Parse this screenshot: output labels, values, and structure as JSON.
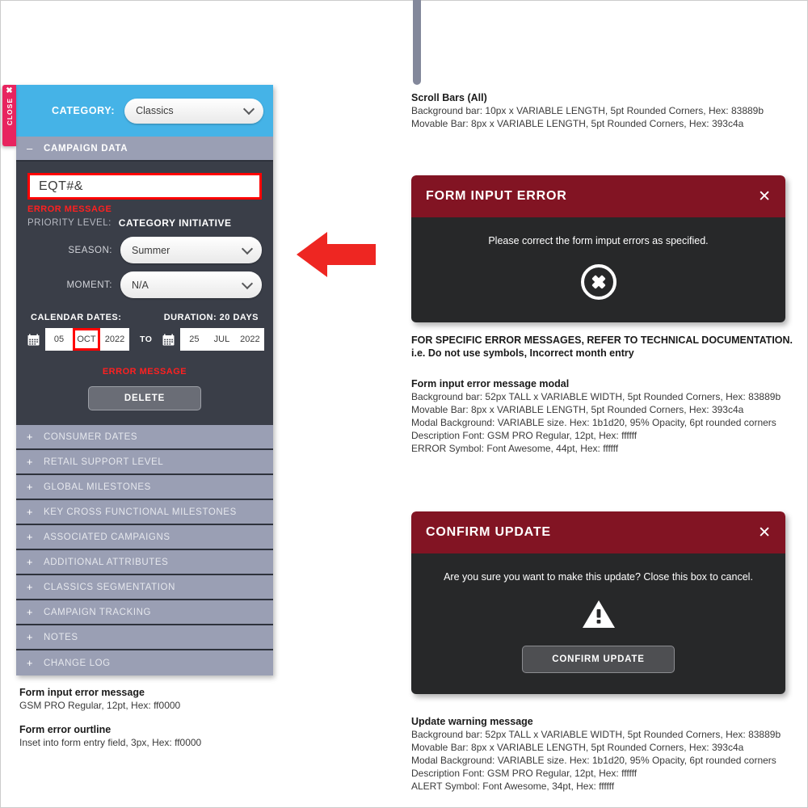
{
  "left_panel": {
    "close_tab": {
      "label": "CLOSE",
      "icon": "close-x-icon"
    },
    "header": {
      "label": "CATEGORY:",
      "category_value": "Classics",
      "bg_hex": "#45b3e7"
    },
    "campaign_section": {
      "sign": "–",
      "title": "CAMPAIGN DATA",
      "name_value": "EQT#&",
      "name_error": "ERROR MESSAGE",
      "priority_label": "PRIORITY LEVEL:",
      "priority_value": "CATEGORY INITIATIVE",
      "season_label": "SEASON:",
      "season_value": "Summer",
      "moment_label": "MOMENT:",
      "moment_value": "N/A",
      "calendar_dates_label": "CALENDAR DATES:",
      "duration_label": "DURATION: 20 DAYS",
      "start_day": "05",
      "start_month": "OCT",
      "start_year": "2022",
      "to_label": "TO",
      "end_day": "25",
      "end_month": "JUL",
      "end_year": "2022",
      "dates_error": "ERROR MESSAGE",
      "delete_label": "DELETE"
    },
    "accordion": [
      {
        "sign": "+",
        "label": "CONSUMER DATES"
      },
      {
        "sign": "+",
        "label": "RETAIL SUPPORT LEVEL"
      },
      {
        "sign": "+",
        "label": "GLOBAL MILESTONES"
      },
      {
        "sign": "+",
        "label": "KEY CROSS FUNCTIONAL MILESTONES"
      },
      {
        "sign": "+",
        "label": "ASSOCIATED CAMPAIGNS"
      },
      {
        "sign": "+",
        "label": "ADDITIONAL ATTRIBUTES"
      },
      {
        "sign": "+",
        "label": "CLASSICS SEGMENTATION"
      },
      {
        "sign": "+",
        "label": "CAMPAIGN TRACKING"
      },
      {
        "sign": "+",
        "label": "NOTES"
      },
      {
        "sign": "+",
        "label": "CHANGE LOG"
      }
    ]
  },
  "left_notes": [
    {
      "title": "Form input error message",
      "lines": [
        "GSM PRO Regular,  12pt, Hex: ff0000"
      ]
    },
    {
      "title": "Form error ourtline",
      "lines": [
        "Inset into form entry field, 3px, Hex: ff0000"
      ]
    }
  ],
  "scrollbar_note": {
    "title": "Scroll Bars (All)",
    "lines": [
      "Background bar:  10px x VARIABLE LENGTH, 5pt Rounded Corners, Hex: 83889b",
      "Movable Bar: 8px x VARIABLE LENGTH, 5pt Rounded Corners, Hex: 393c4a"
    ]
  },
  "error_modal": {
    "title": "FORM INPUT ERROR",
    "close_icon": "close-x-icon",
    "description": "Please correct the form imput errors as specified.",
    "symbol": "error-circle-x-icon",
    "header_hex": "#821423",
    "body_hex": "#272829"
  },
  "error_note": {
    "headline_1": "FOR SPECIFIC ERROR MESSAGES, REFER TO TECHNICAL DOCUMENTATION.",
    "headline_2": "i.e. Do not use symbols, Incorrect month entry",
    "title": "Form input error message modal",
    "lines": [
      "Background bar:  52px TALL x VARIABLE WIDTH, 5pt Rounded Corners, Hex: 83889b",
      "Movable Bar: 8px x VARIABLE LENGTH, 5pt Rounded Corners, Hex: 393c4a",
      "Modal Background: VARIABLE size. Hex: 1b1d20, 95% Opacity, 6pt rounded corners",
      "Description Font: GSM PRO Regular, 12pt, Hex: ffffff",
      "ERROR Symbol: Font Awesome, 44pt, Hex: ffffff"
    ]
  },
  "confirm_modal": {
    "title": "CONFIRM UPDATE",
    "close_icon": "close-x-icon",
    "description": "Are you sure you want to make this update? Close this box to cancel.",
    "symbol": "warning-triangle-icon",
    "button_label": "CONFIRM UPDATE",
    "header_hex": "#821423",
    "body_hex": "#272829"
  },
  "confirm_note": {
    "title": "Update warning message",
    "lines": [
      "Background bar:  52px TALL x VARIABLE WIDTH, 5pt Rounded Corners, Hex: 83889b",
      "Movable Bar: 8px x VARIABLE LENGTH, 5pt Rounded Corners, Hex: 393c4a",
      "Modal Background: VARIABLE size. Hex: 1b1d20, 95% Opacity, 6pt rounded corners",
      "Description Font: GSM PRO Regular, 12pt, Hex: ffffff",
      "ALERT Symbol: Font Awesome, 34pt, Hex: ffffff"
    ]
  }
}
